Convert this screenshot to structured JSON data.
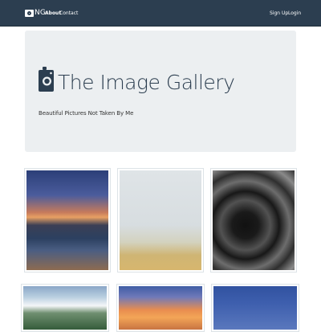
{
  "navbar": {
    "brand": "NG",
    "links": {
      "about": "About",
      "contact": "Contact",
      "signup": "Sign Up",
      "login": "Login"
    }
  },
  "jumbotron": {
    "title": "The Image Gallery",
    "subtitle": "Beautiful Pictures Not Taken By Me"
  },
  "gallery": {
    "thumbnails": [
      {
        "name": "golden-gate-bridge-photo"
      },
      {
        "name": "foggy-beach-photo"
      },
      {
        "name": "spiral-architecture-photo"
      },
      {
        "name": "mountain-photo"
      },
      {
        "name": "sunset-clouds-photo"
      },
      {
        "name": "blue-sky-photo"
      }
    ]
  },
  "colors": {
    "navbar": "#2c3e50",
    "jumbotron": "#eceff1",
    "title": "#2c3e50"
  }
}
